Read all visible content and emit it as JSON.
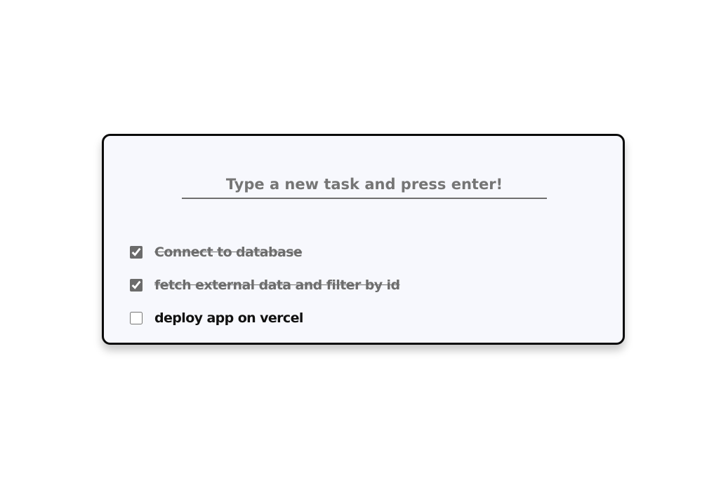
{
  "input": {
    "placeholder": "Type a new task and press enter!",
    "value": ""
  },
  "tasks": [
    {
      "label": "Connect to database",
      "done": true
    },
    {
      "label": "fetch external data and filter by id",
      "done": true
    },
    {
      "label": "deploy app on vercel",
      "done": false
    }
  ],
  "colors": {
    "card_background": "#f7f8fd",
    "card_border": "#0a0a0a",
    "completed_text": "#6d6d6d",
    "checkbox_accent": "#6b6b6b"
  }
}
